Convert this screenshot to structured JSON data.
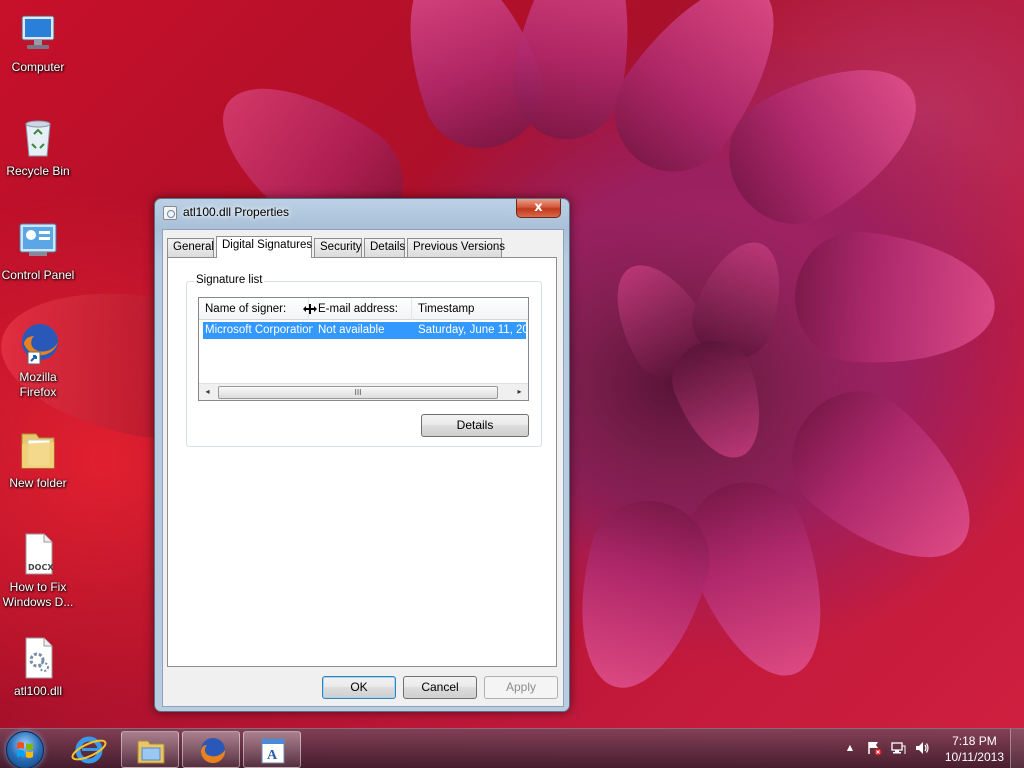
{
  "desktop": {
    "icons": [
      {
        "label": "Computer",
        "icon": "computer-icon"
      },
      {
        "label": "Recycle Bin",
        "icon": "recycle-bin-icon"
      },
      {
        "label": "Control Panel",
        "icon": "control-panel-icon"
      },
      {
        "label": "Mozilla Firefox",
        "icon": "firefox-icon"
      },
      {
        "label": "New folder",
        "icon": "folder-icon"
      },
      {
        "label": "How to Fix Windows D...",
        "icon": "docx-file-icon",
        "badge": "DOCX"
      },
      {
        "label": "atl100.dll",
        "icon": "dll-file-icon"
      }
    ]
  },
  "dialog": {
    "title": "atl100.dll Properties",
    "close_label": "x",
    "tabs": [
      {
        "label": "General"
      },
      {
        "label": "Digital Signatures",
        "active": true
      },
      {
        "label": "Security"
      },
      {
        "label": "Details"
      },
      {
        "label": "Previous Versions"
      }
    ],
    "signature_group_label": "Signature list",
    "columns": [
      "Name of signer:",
      "E-mail address:",
      "Timestamp"
    ],
    "rows": [
      {
        "signer": "Microsoft Corporation",
        "email": "Not available",
        "timestamp": "Saturday, June 11, 20",
        "selected": true
      }
    ],
    "scroll_left": "◂",
    "scroll_right": "▸",
    "scroll_thumb_grip": "III",
    "details_button": "Details",
    "ok_button": "OK",
    "cancel_button": "Cancel",
    "apply_button": "Apply"
  },
  "taskbar": {
    "pinned": [
      {
        "name": "internet-explorer-icon"
      },
      {
        "name": "file-explorer-icon",
        "open": true
      },
      {
        "name": "firefox-icon",
        "open": true
      },
      {
        "name": "wordpad-icon",
        "open": true
      }
    ],
    "tray": {
      "show_hidden": "▲",
      "time": "7:18 PM",
      "date": "10/11/2013"
    }
  },
  "colors": {
    "selection": "#3399ff",
    "window_frame": "#b9cce0",
    "close_button": "#c2381c"
  }
}
